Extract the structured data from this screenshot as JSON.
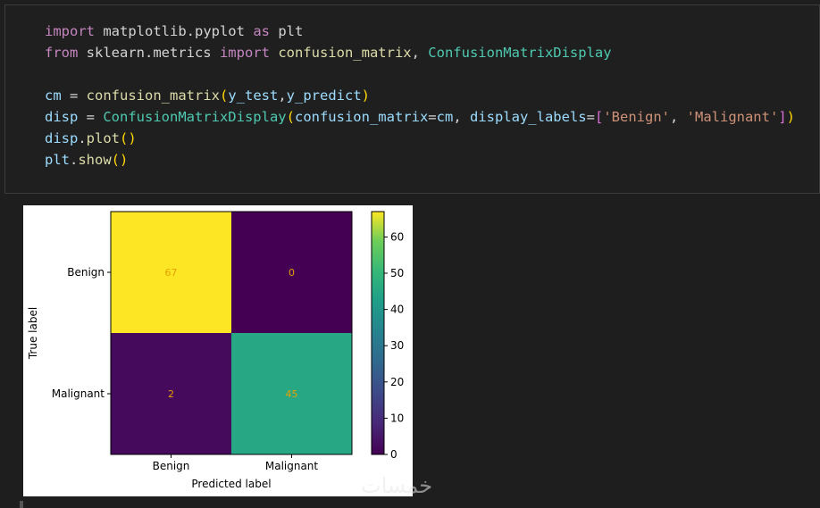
{
  "cell": {
    "lines": [
      [
        {
          "t": "import",
          "c": "kw"
        },
        {
          "t": " matplotlib.pyplot ",
          "c": ""
        },
        {
          "t": "as",
          "c": "kw"
        },
        {
          "t": " plt",
          "c": ""
        }
      ],
      [
        {
          "t": "from",
          "c": "kw"
        },
        {
          "t": " sklearn.metrics ",
          "c": ""
        },
        {
          "t": "import",
          "c": "kw"
        },
        {
          "t": " ",
          "c": ""
        },
        {
          "t": "confusion_matrix",
          "c": "fn"
        },
        {
          "t": ", ",
          "c": ""
        },
        {
          "t": "ConfusionMatrixDisplay",
          "c": "cls"
        }
      ],
      [],
      [
        {
          "t": "cm",
          "c": "var"
        },
        {
          "t": " = ",
          "c": ""
        },
        {
          "t": "confusion_matrix",
          "c": "fn"
        },
        {
          "t": "(",
          "c": "p1"
        },
        {
          "t": "y_test",
          "c": "var"
        },
        {
          "t": ",",
          "c": ""
        },
        {
          "t": "y_predict",
          "c": "var"
        },
        {
          "t": ")",
          "c": "p1"
        }
      ],
      [
        {
          "t": "disp",
          "c": "var"
        },
        {
          "t": " = ",
          "c": ""
        },
        {
          "t": "ConfusionMatrixDisplay",
          "c": "cls"
        },
        {
          "t": "(",
          "c": "p1"
        },
        {
          "t": "confusion_matrix",
          "c": "var"
        },
        {
          "t": "=",
          "c": ""
        },
        {
          "t": "cm",
          "c": "var"
        },
        {
          "t": ", ",
          "c": ""
        },
        {
          "t": "display_labels",
          "c": "var"
        },
        {
          "t": "=",
          "c": ""
        },
        {
          "t": "[",
          "c": "p2"
        },
        {
          "t": "'Benign'",
          "c": "str"
        },
        {
          "t": ", ",
          "c": ""
        },
        {
          "t": "'Malignant'",
          "c": "str"
        },
        {
          "t": "]",
          "c": "p2"
        },
        {
          "t": ")",
          "c": "p1"
        }
      ],
      [
        {
          "t": "disp",
          "c": "var"
        },
        {
          "t": ".",
          "c": ""
        },
        {
          "t": "plot",
          "c": "fn"
        },
        {
          "t": "()",
          "c": "p1"
        }
      ],
      [
        {
          "t": "plt",
          "c": "var"
        },
        {
          "t": ".",
          "c": ""
        },
        {
          "t": "show",
          "c": "fn"
        },
        {
          "t": "()",
          "c": "p1"
        }
      ]
    ]
  },
  "chart_data": {
    "type": "heatmap",
    "xlabel": "Predicted label",
    "ylabel": "True label",
    "x_categories": [
      "Benign",
      "Malignant"
    ],
    "y_categories": [
      "Benign",
      "Malignant"
    ],
    "matrix": [
      [
        67,
        0
      ],
      [
        2,
        45
      ]
    ],
    "cell_text_color": "#e69f00",
    "colormap": "viridis",
    "colorbar": {
      "min": 0,
      "max": 67,
      "ticks": [
        0,
        10,
        20,
        30,
        40,
        50,
        60
      ]
    }
  },
  "watermark": "خمسات"
}
